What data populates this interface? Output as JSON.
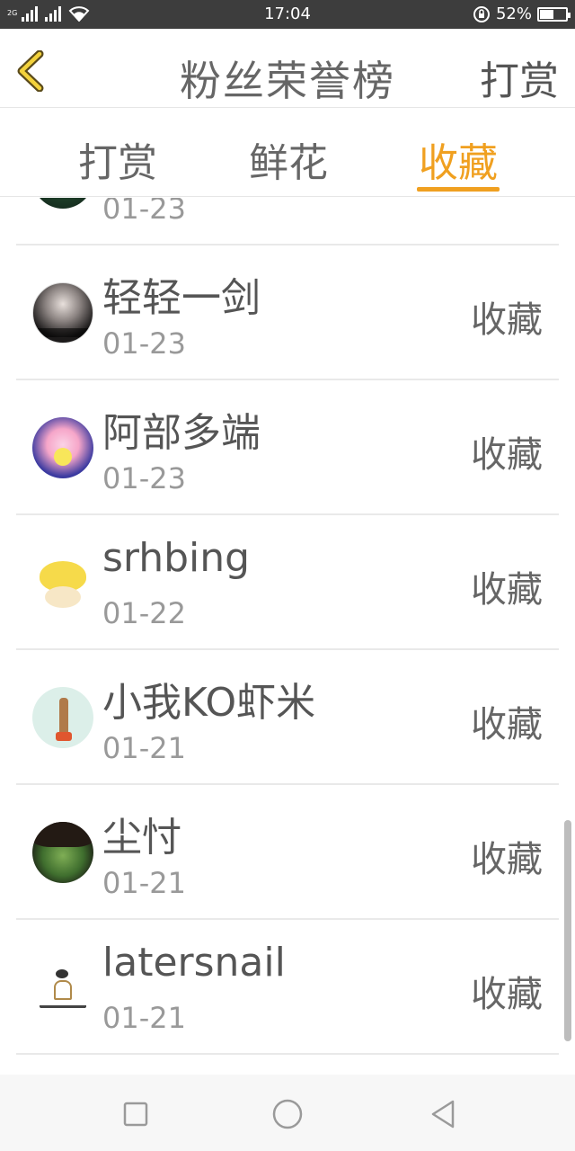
{
  "status_bar": {
    "network_label": "2G",
    "time": "17:04",
    "battery": "52%",
    "battery_level": 0.52
  },
  "header": {
    "title": "粉丝荣誉榜",
    "action_label": "打赏"
  },
  "tabs": [
    {
      "label": "打赏",
      "active": false
    },
    {
      "label": "鲜花",
      "active": false
    },
    {
      "label": "收藏",
      "active": true
    }
  ],
  "list": {
    "items": [
      {
        "name": "",
        "date": "01-23",
        "action": "",
        "avatar": "dark-green-avatar"
      },
      {
        "name": "轻轻一剑",
        "date": "01-23",
        "action": "收藏",
        "avatar": "girl-photo-avatar"
      },
      {
        "name": "阿部多端",
        "date": "01-23",
        "action": "收藏",
        "avatar": "pink-hair-cartoon-avatar"
      },
      {
        "name": "srhbing",
        "date": "01-22",
        "action": "收藏",
        "avatar": "yellow-bird-avatar"
      },
      {
        "name": "小我KO虾米",
        "date": "01-21",
        "action": "收藏",
        "avatar": "toy-figure-avatar"
      },
      {
        "name": "尘忖",
        "date": "01-21",
        "action": "收藏",
        "avatar": "green-face-avatar"
      },
      {
        "name": "latersnail",
        "date": "01-21",
        "action": "收藏",
        "avatar": "bird-cage-avatar"
      }
    ]
  },
  "colors": {
    "accent": "#f0a020",
    "status_bar": "#3d3d3d",
    "text": "#555555",
    "subtext": "#999999"
  }
}
